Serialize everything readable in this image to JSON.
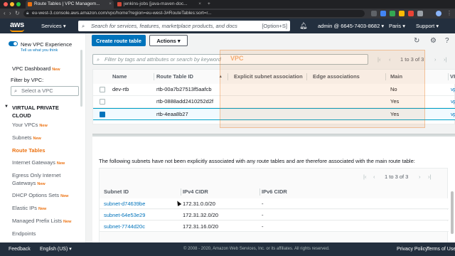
{
  "browser": {
    "tabs": [
      {
        "label": "Route Tables | VPC Managem..."
      },
      {
        "label": "jenkins-jobs [java-maven-doc..."
      }
    ],
    "url": "eu-west-3.console.aws.amazon.com/vpc/home?region=eu-west-3#RouteTables:sort=r..."
  },
  "aws_nav": {
    "logo": "aws",
    "services": "Services",
    "search_placeholder": "Search for services, features, marketplace products, and docs",
    "search_shortcut": "[Option+S]",
    "account": "admin @ 6645-7403-8682",
    "region": "Paris",
    "support": "Support"
  },
  "sidebar": {
    "new_vpc_experience": "New VPC Experience",
    "tell_us": "Tell us what you think",
    "dashboard": "VPC Dashboard",
    "new_badge": "New",
    "filter_label": "Filter by VPC:",
    "select_placeholder": "Select a VPC",
    "section": "VIRTUAL PRIVATE CLOUD",
    "items": [
      {
        "label": "Your VPCs",
        "badge": "New"
      },
      {
        "label": "Subnets",
        "badge": "New"
      },
      {
        "label": "Route Tables",
        "badge": ""
      },
      {
        "label": "Internet Gateways",
        "badge": "New"
      },
      {
        "label": "Egress Only Internet Gateways",
        "badge": "New"
      },
      {
        "label": "DHCP Options Sets",
        "badge": "New"
      },
      {
        "label": "Elastic IPs",
        "badge": "New"
      },
      {
        "label": "Managed Prefix Lists",
        "badge": "New"
      },
      {
        "label": "Endpoints",
        "badge": ""
      }
    ]
  },
  "toolbar": {
    "create": "Create route table",
    "actions": "Actions",
    "filter_placeholder": "Filter by tags and attributes or search by keyword",
    "pager": "1 to 3 of 3"
  },
  "route_table": {
    "headers": [
      "Name",
      "Route Table ID",
      "Explicit subnet association",
      "Edge associations",
      "Main",
      "VP"
    ],
    "rows": [
      {
        "name": "dev-rtb",
        "id": "rtb-00a7b27513f5aafcb",
        "main": "No",
        "vpc": "vp"
      },
      {
        "name": "",
        "id": "rtb-0888add2410252d2f",
        "main": "Yes",
        "vpc": "vp"
      },
      {
        "name": "",
        "id": "rtb-4eaa8b27",
        "main": "Yes",
        "vpc": "vp"
      }
    ],
    "overlay_label": "VPC"
  },
  "detail": {
    "note": "The following subnets have not been explicitly associated with any route tables and are therefore associated with the main route table:",
    "pager": "1 to 3 of 3",
    "headers": [
      "Subnet ID",
      "IPv4 CIDR",
      "IPv6 CIDR"
    ],
    "rows": [
      {
        "subnet": "subnet-d74639be",
        "ipv4": "172.31.0.0/20",
        "ipv6": "-"
      },
      {
        "subnet": "subnet-64e53e29",
        "ipv4": "172.31.32.0/20",
        "ipv6": "-"
      },
      {
        "subnet": "subnet-7744d20c",
        "ipv4": "172.31.16.0/20",
        "ipv6": "-"
      }
    ]
  },
  "footer": {
    "feedback": "Feedback",
    "language": "English (US)",
    "copyright": "© 2008 - 2020, Amazon Web Services, Inc. or its affiliates. All rights reserved.",
    "privacy": "Privacy Policy",
    "terms": "Terms of Use"
  },
  "colors": {
    "aws_navy": "#232f3e",
    "aws_orange": "#ec7211",
    "link_blue": "#0073bb"
  }
}
